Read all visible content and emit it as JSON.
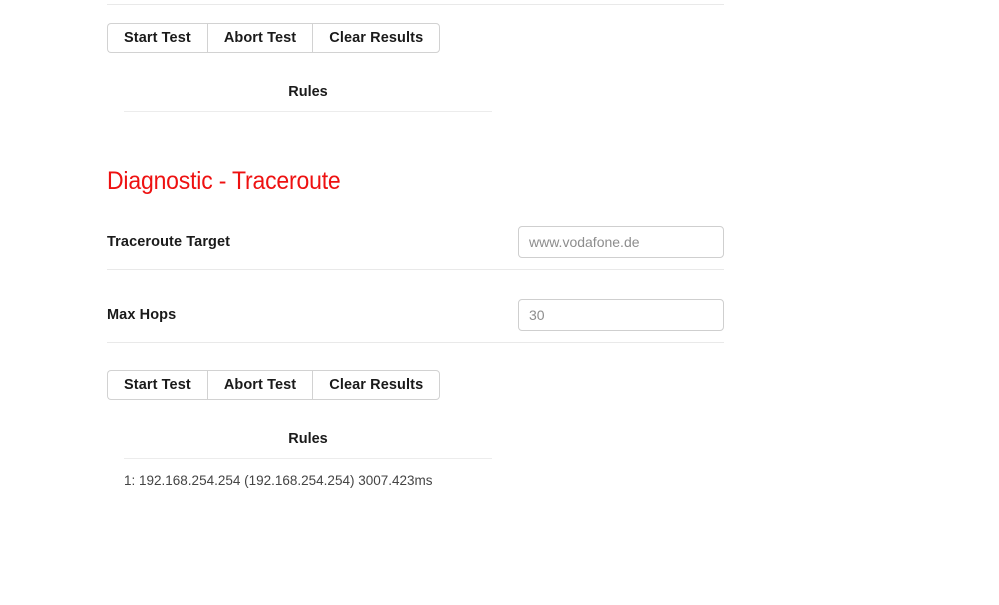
{
  "top_section": {
    "buttons": [
      {
        "label": "Start Test",
        "name": "start-test-button"
      },
      {
        "label": "Abort Test",
        "name": "abort-test-button"
      },
      {
        "label": "Clear Results",
        "name": "clear-results-button"
      }
    ],
    "rules_title": "Rules",
    "rules_output": ""
  },
  "traceroute_section": {
    "title": "Diagnostic - Traceroute",
    "title_color": "#EE1111",
    "fields": [
      {
        "label": "Traceroute Target",
        "value": "",
        "placeholder": "www.vodafone.de"
      },
      {
        "label": "Max Hops",
        "value": "",
        "placeholder": "30"
      }
    ],
    "buttons": [
      {
        "label": "Start Test",
        "name": "start-test-button"
      },
      {
        "label": "Abort Test",
        "name": "abort-test-button"
      },
      {
        "label": "Clear Results",
        "name": "clear-results-button"
      }
    ],
    "rules_title": "Rules",
    "rules_output": "1: 192.168.254.254 (192.168.254.254) 3007.423ms"
  }
}
